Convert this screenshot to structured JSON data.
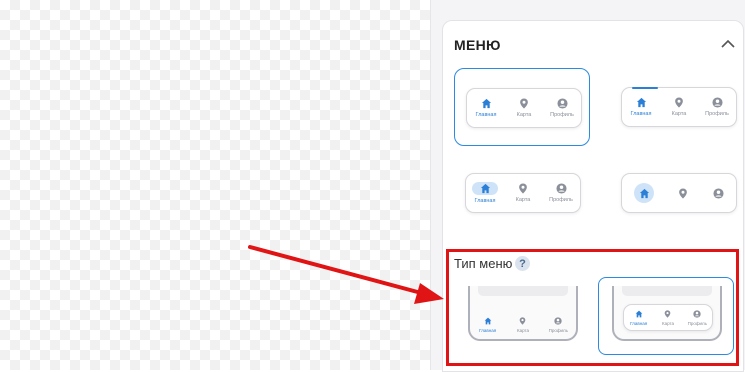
{
  "menu_section": {
    "title": "МЕНЮ",
    "nav_labels": {
      "home": "Главная",
      "map": "Карта",
      "profile": "Профиль"
    },
    "selected_style_index": 0
  },
  "menu_type": {
    "label": "Тип меню",
    "help": "?",
    "selected_index": 1
  },
  "colors": {
    "accent": "#2b7fd6",
    "highlight_box": "#e01414",
    "arrow": "#e01414"
  },
  "icons": [
    "home-icon",
    "map-pin-icon",
    "profile-icon",
    "chevron-up-icon",
    "help-icon"
  ]
}
